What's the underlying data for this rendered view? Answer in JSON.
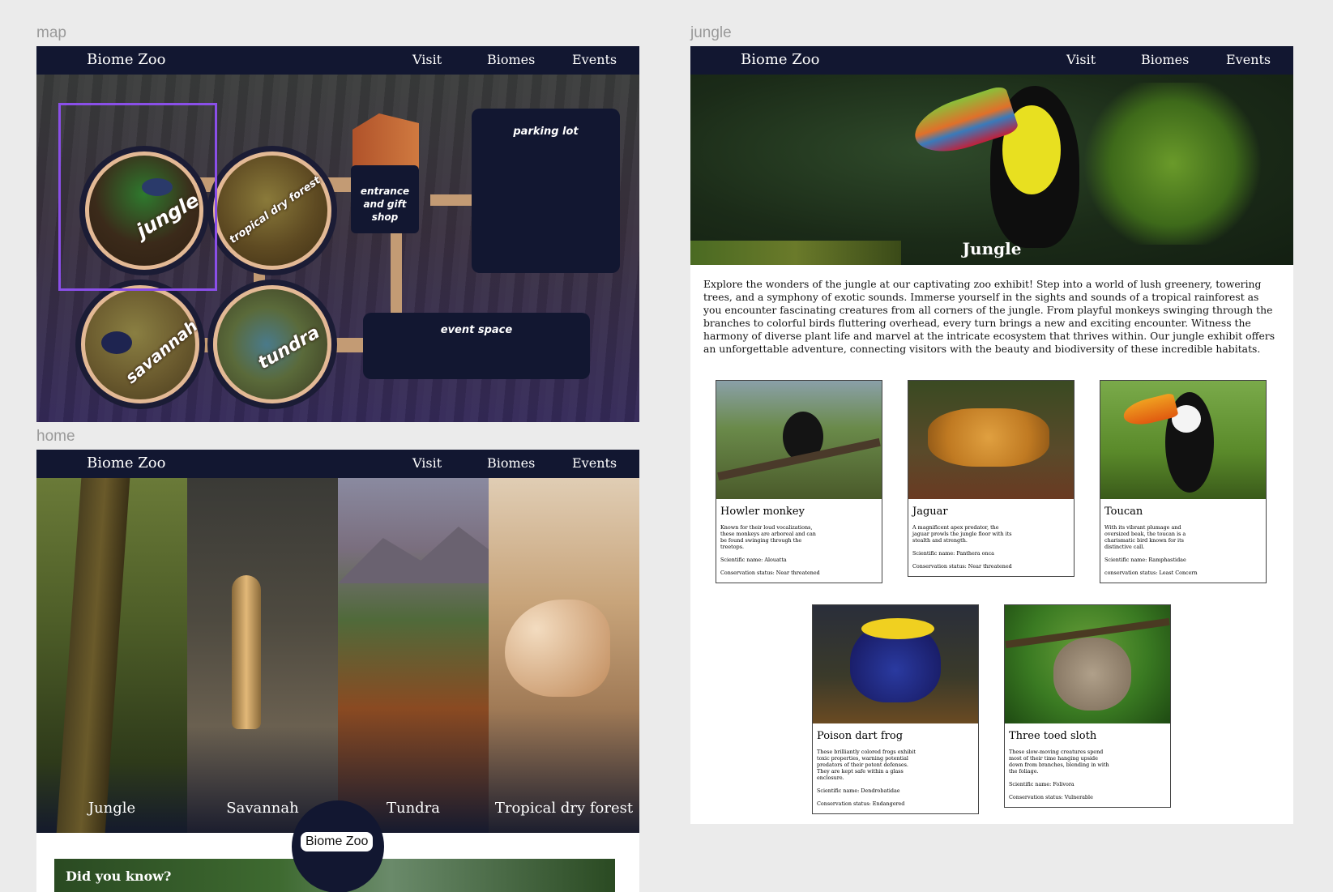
{
  "frames": {
    "map": {
      "label": "map",
      "nav": {
        "brand": "Biome Zoo",
        "links": [
          "Visit",
          "Biomes",
          "Events"
        ]
      },
      "biomes": [
        "jungle",
        "tropical dry forest",
        "savannah",
        "tundra"
      ],
      "areas": {
        "entrance": "entrance and gift shop",
        "parking": "parking lot",
        "event_space": "event space"
      },
      "selection_color": "#8a4fe8"
    },
    "home": {
      "label": "home",
      "nav": {
        "brand": "Biome Zoo",
        "links": [
          "Visit",
          "Biomes",
          "Events"
        ]
      },
      "columns": [
        "Jungle",
        "Savannah",
        "Tundra",
        "Tropical dry forest"
      ],
      "badge": "Biome Zoo",
      "did_you_know": "Did you know?"
    },
    "jungle": {
      "label": "jungle",
      "nav": {
        "brand": "Biome Zoo",
        "links": [
          "Visit",
          "Biomes",
          "Events"
        ]
      },
      "hero_title": "Jungle",
      "intro": "Explore the wonders of the jungle at our captivating zoo exhibit! Step into a world of lush greenery, towering trees, and a symphony of exotic sounds. Immerse yourself in the sights and sounds of a tropical rainforest as you encounter fascinating creatures from all corners of the jungle. From playful monkeys swinging through the branches to colorful birds fluttering overhead, every turn brings a new and exciting encounter. Witness the harmony of diverse plant life and marvel at the intricate ecosystem that thrives within. Our jungle exhibit offers an unforgettable adventure, connecting visitors with the beauty and biodiversity of these incredible habitats.",
      "animals": [
        {
          "name": "Howler monkey",
          "desc": "Known for their loud vocalizations, these monkeys are arboreal and can be found swinging through the treetops.",
          "sci": "Scientific name: Alouatta",
          "cons": "Conservation status: Near threatened"
        },
        {
          "name": "Jaguar",
          "desc": "A magnificent apex predator, the jaguar prowls the jungle floor with its stealth and strength.",
          "sci": "Scientific name: Panthera onca",
          "cons": "Conservation status: Near threatened"
        },
        {
          "name": "Toucan",
          "desc": "With its vibrant plumage and oversized beak, the toucan is a charismatic bird known for its distinctive call.",
          "sci": "Scientific name: Ramphastidae",
          "cons": "conservation status: Least Concern"
        },
        {
          "name": "Poison dart frog",
          "desc": "These brilliantly colored frogs exhibit toxic properties, warning potential predators of their potent defenses. They are kept safe within a glass enclosure.",
          "sci": "Scientific name: Dendrobatidae",
          "cons": "Conservation status: Endangered"
        },
        {
          "name": "Three toed sloth",
          "desc": "These slow-moving creatures spend most of their time hanging upside down from branches, blending in with the foliage.",
          "sci": "Scientific name: Folivora",
          "cons": "Conservation status: Vulnerable"
        }
      ]
    }
  }
}
